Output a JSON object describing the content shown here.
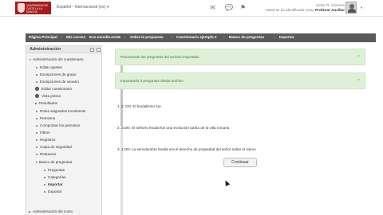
{
  "header": {
    "logo_text": "UNIVERSIDAD DE CASTILLA-LA MANCHA",
    "language": "Español - Internacional (es)",
    "icons": [
      "envelope-icon",
      "chat-icon",
      "flag-icon"
    ],
    "user_line1": "Víctor R. Cáceres",
    "user_line2_prefix": "Usted se ha identificado como",
    "user_role": "Profesor Auxiliar"
  },
  "breadcrumb": [
    "Página Principal",
    "Mis cursos",
    "Eco.moodle.ecl18",
    "Sobre la propuesta",
    "Cuestionario ejemplo 2",
    "Banco de preguntas",
    "Importar"
  ],
  "sidebar": {
    "title": "Administración",
    "items": [
      {
        "label": "Administración del cuestionario",
        "level": 0,
        "icon": "expanded"
      },
      {
        "label": "Editar ajustes",
        "level": 1,
        "icon": "dot"
      },
      {
        "label": "Excepciones de grupo",
        "level": 1,
        "icon": "dot"
      },
      {
        "label": "Excepciones de usuario",
        "level": 1,
        "icon": "dot"
      },
      {
        "label": "Editar cuestionario",
        "level": 1,
        "icon": "gear"
      },
      {
        "label": "Vista previa",
        "level": 1,
        "icon": "gear"
      },
      {
        "label": "Resultados",
        "level": 1,
        "icon": "collapsed"
      },
      {
        "label": "Roles asignados localmente",
        "level": 1,
        "icon": "dot"
      },
      {
        "label": "Permisos",
        "level": 1,
        "icon": "dot"
      },
      {
        "label": "Comprobar los permisos",
        "level": 1,
        "icon": "dot"
      },
      {
        "label": "Filtros",
        "level": 1,
        "icon": "dot"
      },
      {
        "label": "Registros",
        "level": 1,
        "icon": "dot"
      },
      {
        "label": "Copia de seguridad",
        "level": 1,
        "icon": "dot"
      },
      {
        "label": "Restaurar",
        "level": 1,
        "icon": "dot"
      },
      {
        "label": "Banco de preguntas",
        "level": 1,
        "icon": "expanded"
      },
      {
        "label": "Preguntas",
        "level": 2,
        "icon": "dot"
      },
      {
        "label": "Categorías",
        "level": 2,
        "icon": "dot"
      },
      {
        "label": "Importar",
        "level": 2,
        "icon": "dot",
        "current": true
      },
      {
        "label": "Exportar",
        "level": 2,
        "icon": "dot"
      },
      {
        "label": "Administración del curso",
        "level": 0,
        "icon": "collapsed"
      }
    ]
  },
  "main": {
    "notices": [
      {
        "text": "Procesando las preguntas del archivo importado",
        "close": "×"
      },
      {
        "text": "Importando 3 preguntas desde archivo",
        "close": "×"
      }
    ],
    "questions": [
      "1. 2. DN: El feudalismo fue",
      "2. 3.DN: El señorío feudal fue una evolución tardía de la villa romana",
      "3. 4.DN: La servidumbre feudal era el derecho de propiedad del señor sobre el siervo"
    ],
    "continue_label": "Continuar"
  }
}
